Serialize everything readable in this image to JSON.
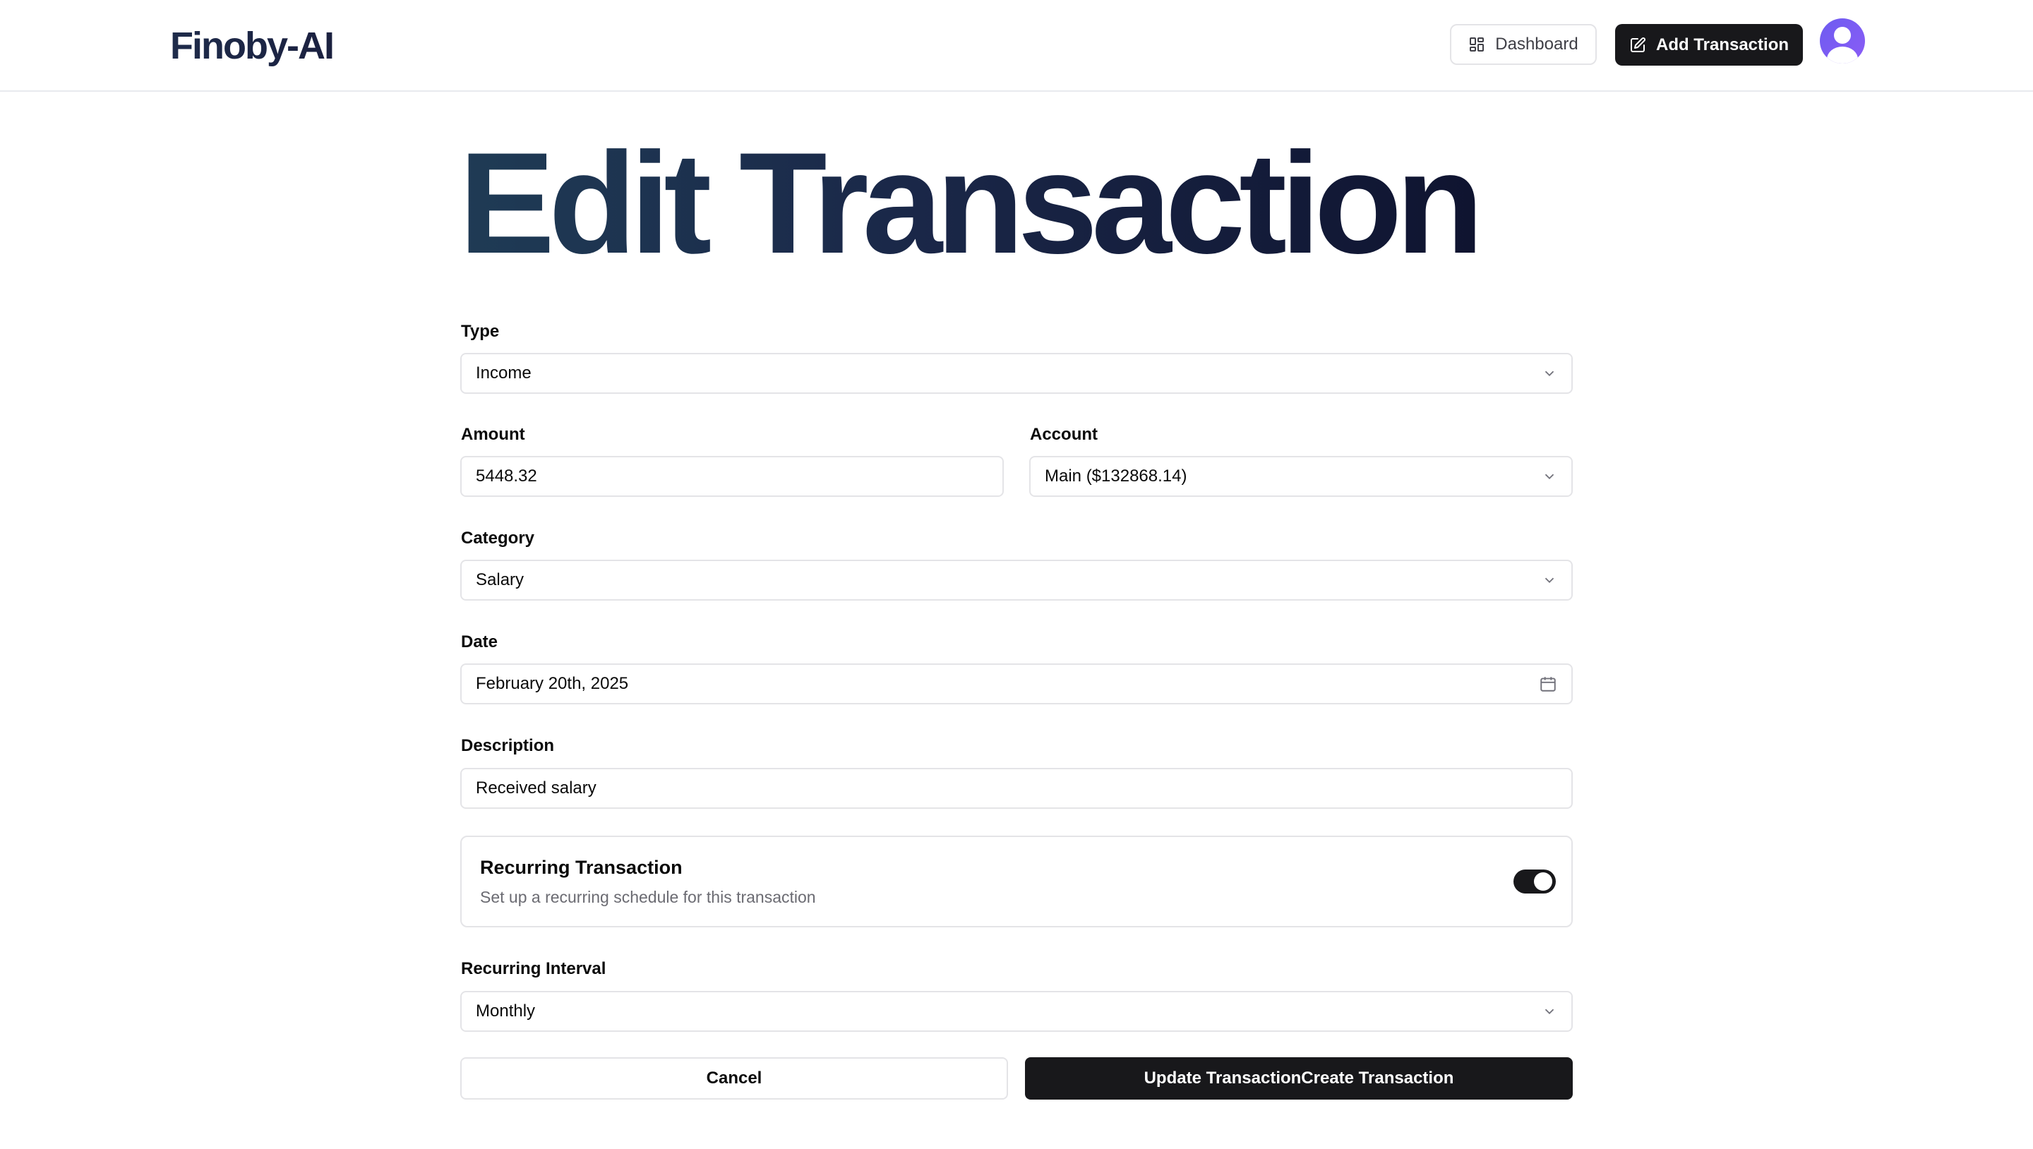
{
  "header": {
    "logo": "Finoby-AI",
    "dashboard_label": "Dashboard",
    "add_transaction_label": "Add Transaction"
  },
  "page_title": "Edit Transaction",
  "form": {
    "type": {
      "label": "Type",
      "value": "Income"
    },
    "amount": {
      "label": "Amount",
      "value": "5448.32"
    },
    "account": {
      "label": "Account",
      "value": "Main ($132868.14)"
    },
    "category": {
      "label": "Category",
      "value": "Salary"
    },
    "date": {
      "label": "Date",
      "value": "February 20th, 2025"
    },
    "description": {
      "label": "Description",
      "value": "Received salary"
    },
    "recurring": {
      "title": "Recurring Transaction",
      "subtitle": "Set up a recurring schedule for this transaction",
      "enabled": true
    },
    "recurring_interval": {
      "label": "Recurring Interval",
      "value": "Monthly"
    },
    "cancel_label": "Cancel",
    "submit_label": "Update TransactionCreate Transaction"
  },
  "colors": {
    "primary_button": "#18181b",
    "border": "#e4e4e7",
    "avatar": "#7c5cf4"
  }
}
